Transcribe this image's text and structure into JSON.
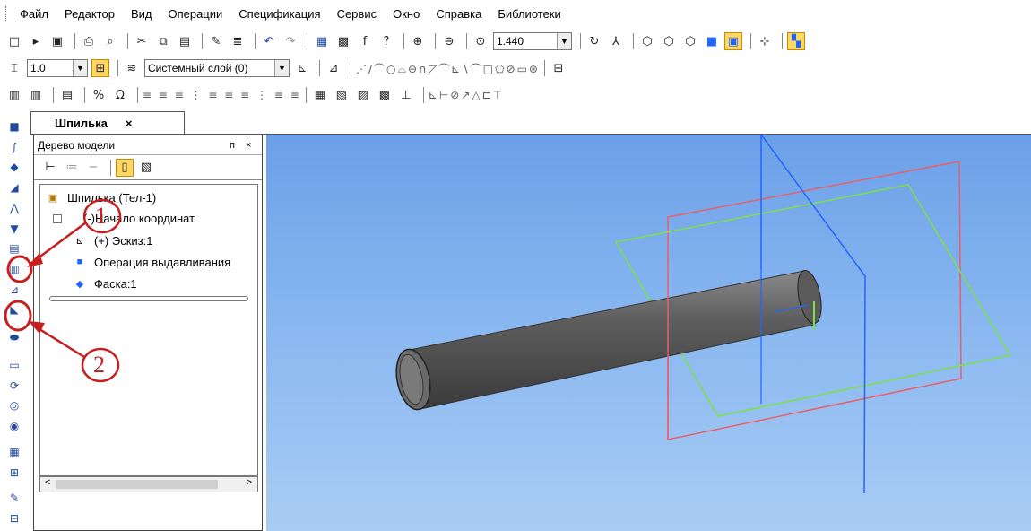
{
  "menu": [
    "Файл",
    "Редактор",
    "Вид",
    "Операции",
    "Спецификация",
    "Сервис",
    "Окно",
    "Справка",
    "Библиотеки"
  ],
  "toolbar1": {
    "zoom_value": "1.440"
  },
  "toolbar2": {
    "line_width": "1.0",
    "layer": "Системный слой (0)"
  },
  "document": {
    "tab_title": "Шпилька",
    "close": "×"
  },
  "tree_panel": {
    "title": "Дерево модели",
    "pin": "п",
    "close": "×",
    "items": [
      {
        "label": "Шпилька (Тел-1)"
      },
      {
        "label": "(-)Начало координат"
      },
      {
        "label": "(+) Эскиз:1"
      },
      {
        "label": "Операция выдавливания"
      },
      {
        "label": "Фаска:1"
      }
    ],
    "scroll_left": "<",
    "scroll_right": ">"
  },
  "annotations": [
    "1",
    "2"
  ],
  "colors": {
    "viewport_top": "#6ba0e8",
    "viewport_bottom": "#a9ccf4",
    "plane_red": "#e8606a",
    "plane_green": "#7be04a",
    "axis_blue": "#1f66ff",
    "annotation_red": "#c81e1e",
    "highlight": "#ffd763"
  },
  "icons": [
    "new-icon",
    "open-icon",
    "save-icon",
    "print-icon",
    "preview-icon",
    "cut-icon",
    "copy-icon",
    "paste-icon",
    "undo-icon",
    "redo-icon",
    "zoom-in-icon",
    "zoom-out-icon",
    "rotate-icon",
    "orientation-icon",
    "extrude-icon",
    "cylinder-icon"
  ]
}
